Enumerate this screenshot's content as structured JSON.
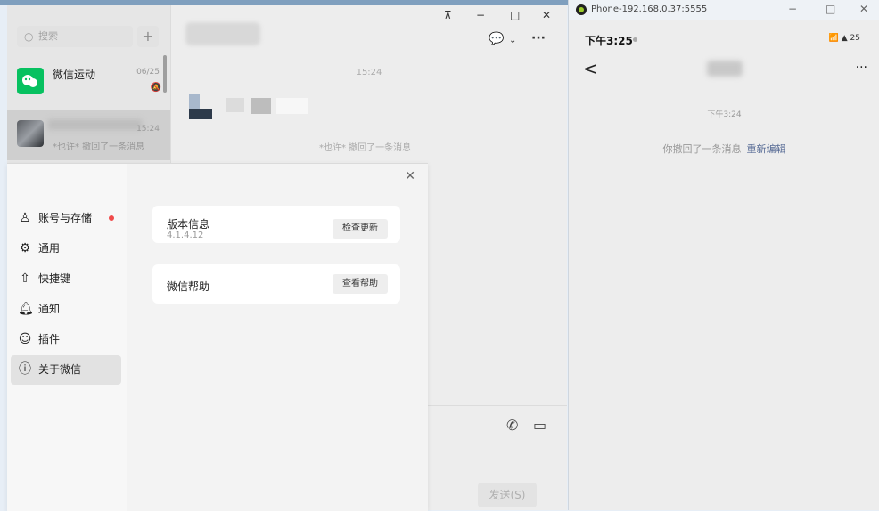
{
  "wechat": {
    "search_placeholder": "搜索",
    "add_icon": "+",
    "chats": [
      {
        "name": "微信运动",
        "time": "06/25",
        "message": ""
      },
      {
        "name": "",
        "time": "15:24",
        "message": "*也许* 撤回了一条消息"
      }
    ],
    "chat": {
      "time": "15:24",
      "recall_notice": "*也许* 撤回了一条消息",
      "send_button": "发送(S)"
    },
    "window_controls": {
      "pin": "⊼",
      "minimize": "−",
      "maximize": "□",
      "close": "✕"
    },
    "header_icons": {
      "chat_bubble": "chat-bubble-icon",
      "chevron": "chevron-down-icon",
      "more": "more-icon"
    }
  },
  "settings": {
    "close": "✕",
    "sidebar": [
      {
        "label": "账号与存储",
        "icon": "account-icon",
        "has_dot": true
      },
      {
        "label": "通用",
        "icon": "gear-icon"
      },
      {
        "label": "快捷键",
        "icon": "shortcut-icon"
      },
      {
        "label": "通知",
        "icon": "bell-icon"
      },
      {
        "label": "插件",
        "icon": "plugin-icon"
      },
      {
        "label": "关于微信",
        "icon": "info-icon",
        "active": true
      }
    ],
    "version_card": {
      "title": "版本信息",
      "version": "4.1.4.12",
      "button": "检查更新"
    },
    "help_card": {
      "title": "微信帮助",
      "button": "查看帮助"
    }
  },
  "phone": {
    "window_title": "Phone-192.168.0.37:5555",
    "window_controls": {
      "minimize": "−",
      "maximize": "□",
      "close": "✕"
    },
    "status_time": "下午3:25",
    "status_right": "📶 ▲ 25",
    "back": "<",
    "more": "···",
    "chat_time": "下午3:24",
    "recall_text": "你撤回了一条消息",
    "reedit": "重新编辑"
  },
  "colors": {
    "wechat_green": "#07c160",
    "link_blue": "#576b95",
    "red_dot": "#f04a4a"
  }
}
